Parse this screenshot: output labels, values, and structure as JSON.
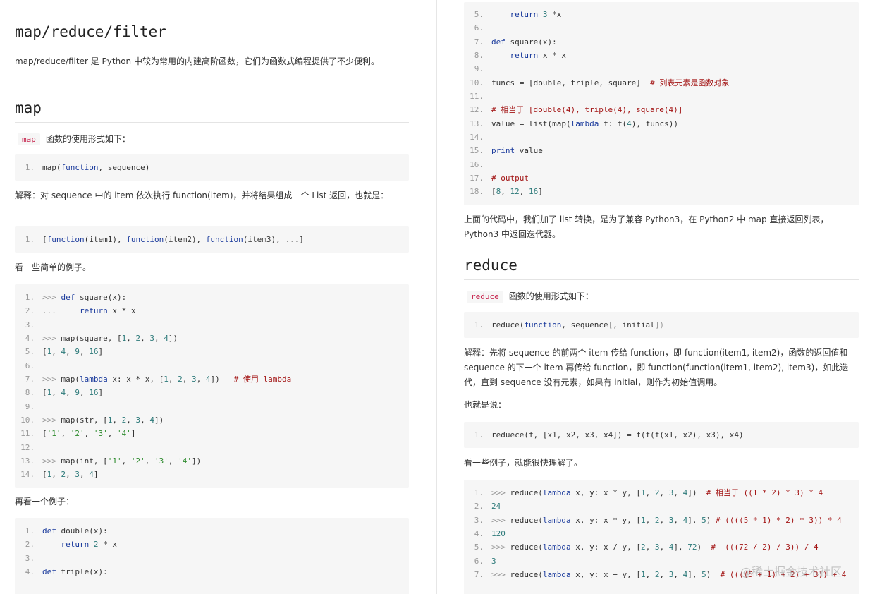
{
  "left": {
    "title": "map/reduce/filter",
    "intro": "map/reduce/filter 是 Python 中较为常用的内建高阶函数，它们为函数式编程提供了不少便利。",
    "map_heading": "map",
    "map_code_label": "map",
    "map_usage_text": "函数的使用形式如下：",
    "map_sig": [
      [
        [
          "map(",
          ""
        ],
        [
          "function",
          "k"
        ],
        [
          ", sequence)",
          ""
        ]
      ]
    ],
    "explain": "解释：对 sequence 中的 item 依次执行 function(item)，并将结果组成一个 List 返回，也就是：",
    "expand": [
      [
        [
          "[",
          ""
        ],
        [
          "function",
          "k"
        ],
        [
          "(item1), ",
          ""
        ],
        [
          "function",
          "k"
        ],
        [
          "(item2), ",
          ""
        ],
        [
          "function",
          "k"
        ],
        [
          "(item3), ",
          ""
        ],
        [
          "...",
          "o"
        ],
        [
          "]",
          ""
        ]
      ]
    ],
    "simple_examples": "看一些简单的例子。",
    "examples1": [
      [
        [
          ">>> ",
          "o"
        ],
        [
          "def",
          "k"
        ],
        [
          " square(x):",
          ""
        ]
      ],
      [
        [
          "...     ",
          "o"
        ],
        [
          "return",
          "k"
        ],
        [
          " x * x",
          ""
        ]
      ],
      [],
      [
        [
          ">>> ",
          "o"
        ],
        [
          "map(square, [",
          ""
        ],
        [
          "1",
          "n"
        ],
        [
          ", ",
          ""
        ],
        [
          "2",
          "n"
        ],
        [
          ", ",
          ""
        ],
        [
          "3",
          "n"
        ],
        [
          ", ",
          ""
        ],
        [
          "4",
          "n"
        ],
        [
          "])",
          ""
        ]
      ],
      [
        [
          "[",
          ""
        ],
        [
          "1",
          "n"
        ],
        [
          ", ",
          ""
        ],
        [
          "4",
          "n"
        ],
        [
          ", ",
          ""
        ],
        [
          "9",
          "n"
        ],
        [
          ", ",
          ""
        ],
        [
          "16",
          "n"
        ],
        [
          "]",
          ""
        ]
      ],
      [],
      [
        [
          ">>> ",
          "o"
        ],
        [
          "map(",
          ""
        ],
        [
          "lambda",
          "k"
        ],
        [
          " x: x * x, [",
          ""
        ],
        [
          "1",
          "n"
        ],
        [
          ", ",
          ""
        ],
        [
          "2",
          "n"
        ],
        [
          ", ",
          ""
        ],
        [
          "3",
          "n"
        ],
        [
          ", ",
          ""
        ],
        [
          "4",
          "n"
        ],
        [
          "])   ",
          ""
        ],
        [
          "# 使用 lambda",
          "c"
        ]
      ],
      [
        [
          "[",
          ""
        ],
        [
          "1",
          "n"
        ],
        [
          ", ",
          ""
        ],
        [
          "4",
          "n"
        ],
        [
          ", ",
          ""
        ],
        [
          "9",
          "n"
        ],
        [
          ", ",
          ""
        ],
        [
          "16",
          "n"
        ],
        [
          "]",
          ""
        ]
      ],
      [],
      [
        [
          ">>> ",
          "o"
        ],
        [
          "map(str, [",
          ""
        ],
        [
          "1",
          "n"
        ],
        [
          ", ",
          ""
        ],
        [
          "2",
          "n"
        ],
        [
          ", ",
          ""
        ],
        [
          "3",
          "n"
        ],
        [
          ", ",
          ""
        ],
        [
          "4",
          "n"
        ],
        [
          "])",
          ""
        ]
      ],
      [
        [
          "[",
          ""
        ],
        [
          "'1'",
          "s"
        ],
        [
          ", ",
          ""
        ],
        [
          "'2'",
          "s"
        ],
        [
          ", ",
          ""
        ],
        [
          "'3'",
          "s"
        ],
        [
          ", ",
          ""
        ],
        [
          "'4'",
          "s"
        ],
        [
          "]",
          ""
        ]
      ],
      [],
      [
        [
          ">>> ",
          "o"
        ],
        [
          "map(int, [",
          ""
        ],
        [
          "'1'",
          "s"
        ],
        [
          ", ",
          ""
        ],
        [
          "'2'",
          "s"
        ],
        [
          ", ",
          ""
        ],
        [
          "'3'",
          "s"
        ],
        [
          ", ",
          ""
        ],
        [
          "'4'",
          "s"
        ],
        [
          "])",
          ""
        ]
      ],
      [
        [
          "[",
          ""
        ],
        [
          "1",
          "n"
        ],
        [
          ", ",
          ""
        ],
        [
          "2",
          "n"
        ],
        [
          ", ",
          ""
        ],
        [
          "3",
          "n"
        ],
        [
          ", ",
          ""
        ],
        [
          "4",
          "n"
        ],
        [
          "]",
          ""
        ]
      ]
    ],
    "another_example": "再看一个例子：",
    "examples2": [
      [
        [
          "def",
          "k"
        ],
        [
          " double(x):",
          ""
        ]
      ],
      [
        [
          "    ",
          ""
        ],
        [
          "return",
          "k"
        ],
        [
          " ",
          ""
        ],
        [
          "2",
          "n"
        ],
        [
          " * x",
          ""
        ]
      ],
      [],
      [
        [
          "def",
          "k"
        ],
        [
          " triple(x):",
          ""
        ]
      ]
    ]
  },
  "right": {
    "code_cont": {
      "start": 5,
      "lines": [
        [
          [
            "    ",
            ""
          ],
          [
            "return",
            "k"
          ],
          [
            " ",
            ""
          ],
          [
            "3",
            "n"
          ],
          [
            " *x",
            ""
          ]
        ],
        [],
        [
          [
            "def",
            "k"
          ],
          [
            " square(x):",
            ""
          ]
        ],
        [
          [
            "    ",
            ""
          ],
          [
            "return",
            "k"
          ],
          [
            " x * x",
            ""
          ]
        ],
        [],
        [
          [
            "funcs = [double, triple, square]  ",
            ""
          ],
          [
            "# 列表元素是函数对象",
            "c"
          ]
        ],
        [],
        [
          [
            "# 相当于 [double(4), triple(4), square(4)]",
            "c"
          ]
        ],
        [
          [
            "value = list(map(",
            ""
          ],
          [
            "lambda",
            "k"
          ],
          [
            " f: f(",
            ""
          ],
          [
            "4",
            "n"
          ],
          [
            "), funcs))",
            ""
          ]
        ],
        [],
        [
          [
            "print",
            "k"
          ],
          [
            " value",
            ""
          ]
        ],
        [],
        [
          [
            "# output",
            "c"
          ]
        ],
        [
          [
            "[",
            ""
          ],
          [
            "8",
            "n"
          ],
          [
            ", ",
            ""
          ],
          [
            "12",
            "n"
          ],
          [
            ", ",
            ""
          ],
          [
            "16",
            "n"
          ],
          [
            "]",
            ""
          ]
        ]
      ]
    },
    "note": "上面的代码中，我们加了 list 转换，是为了兼容 Python3，在 Python2 中 map 直接返回列表，Python3 中返回迭代器。",
    "reduce_heading": "reduce",
    "reduce_code_label": "reduce",
    "reduce_usage_text": "函数的使用形式如下：",
    "reduce_sig": [
      [
        [
          "reduce(",
          ""
        ],
        [
          "function",
          "k"
        ],
        [
          ", sequence",
          ""
        ],
        [
          "[",
          "o"
        ],
        [
          ", initial",
          ""
        ],
        [
          "])",
          "o"
        ]
      ]
    ],
    "reduce_explain": "解释：先将 sequence 的前两个 item 传给 function，即 function(item1, item2)，函数的返回值和 sequence 的下一个 item 再传给 function，即 function(function(item1, item2), item3)，如此迭代，直到 sequence 没有元素，如果有 initial，则作为初始值调用。",
    "that_is": "也就是说：",
    "reduce_expand": [
      [
        [
          "reduece(f, [x1, x2, x3, x4]) = f(f(f(x1, x2), x3), x4)",
          ""
        ]
      ]
    ],
    "examples_intro": "看一些例子，就能很快理解了。",
    "reduce_examples": [
      [
        [
          ">>> ",
          "o"
        ],
        [
          "reduce(",
          ""
        ],
        [
          "lambda",
          "k"
        ],
        [
          " x, y: x * y, [",
          ""
        ],
        [
          "1",
          "n"
        ],
        [
          ", ",
          ""
        ],
        [
          "2",
          "n"
        ],
        [
          ", ",
          ""
        ],
        [
          "3",
          "n"
        ],
        [
          ", ",
          ""
        ],
        [
          "4",
          "n"
        ],
        [
          "])  ",
          ""
        ],
        [
          "# 相当于 ((1 * 2) * 3) * 4",
          "c"
        ]
      ],
      [
        [
          "24",
          "n"
        ]
      ],
      [
        [
          ">>> ",
          "o"
        ],
        [
          "reduce(",
          ""
        ],
        [
          "lambda",
          "k"
        ],
        [
          " x, y: x * y, [",
          ""
        ],
        [
          "1",
          "n"
        ],
        [
          ", ",
          ""
        ],
        [
          "2",
          "n"
        ],
        [
          ", ",
          ""
        ],
        [
          "3",
          "n"
        ],
        [
          ", ",
          ""
        ],
        [
          "4",
          "n"
        ],
        [
          "], ",
          ""
        ],
        [
          "5",
          "n"
        ],
        [
          ") ",
          ""
        ],
        [
          "# ((((5 * 1) * 2) * 3)) * 4",
          "c"
        ]
      ],
      [
        [
          "120",
          "n"
        ]
      ],
      [
        [
          ">>> ",
          "o"
        ],
        [
          "reduce(",
          ""
        ],
        [
          "lambda",
          "k"
        ],
        [
          " x, y: x / y, [",
          ""
        ],
        [
          "2",
          "n"
        ],
        [
          ", ",
          ""
        ],
        [
          "3",
          "n"
        ],
        [
          ", ",
          ""
        ],
        [
          "4",
          "n"
        ],
        [
          "], ",
          ""
        ],
        [
          "72",
          "n"
        ],
        [
          ")  ",
          ""
        ],
        [
          "#  (((72 / 2) / 3)) / 4",
          "c"
        ]
      ],
      [
        [
          "3",
          "n"
        ]
      ],
      [
        [
          ">>> ",
          "o"
        ],
        [
          "reduce(",
          ""
        ],
        [
          "lambda",
          "k"
        ],
        [
          " x, y: x + y, [",
          ""
        ],
        [
          "1",
          "n"
        ],
        [
          ", ",
          ""
        ],
        [
          "2",
          "n"
        ],
        [
          ", ",
          ""
        ],
        [
          "3",
          "n"
        ],
        [
          ", ",
          ""
        ],
        [
          "4",
          "n"
        ],
        [
          "], ",
          ""
        ],
        [
          "5",
          "n"
        ],
        [
          ")  ",
          ""
        ],
        [
          "# ((((5 + 1) + 2) + 3)) + 4",
          "c"
        ]
      ]
    ]
  },
  "watermark": "@稀土掘金技术社区"
}
